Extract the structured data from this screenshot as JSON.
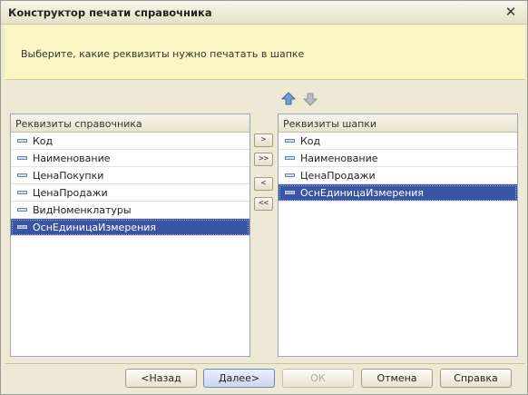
{
  "window": {
    "title": "Конструктор печати справочника",
    "close_glyph": "✕"
  },
  "hint": "Выберите, какие реквизиты нужно печатать в шапке",
  "left_list": {
    "header": "Реквизиты справочника",
    "items": [
      {
        "label": "Код"
      },
      {
        "label": "Наименование"
      },
      {
        "label": "ЦенаПокупки"
      },
      {
        "label": "ЦенаПродажи"
      },
      {
        "label": "ВидНоменклатуры"
      },
      {
        "label": "ОснЕдиницаИзмерения",
        "selected": true
      }
    ]
  },
  "right_list": {
    "header": "Реквизиты шапки",
    "items": [
      {
        "label": "Код"
      },
      {
        "label": "Наименование"
      },
      {
        "label": "ЦенаПродажи"
      },
      {
        "label": "ОснЕдиницаИзмерения",
        "selected": true
      }
    ]
  },
  "move_buttons": {
    "add_one": ">",
    "add_all": ">>",
    "remove_one": "<",
    "remove_all": "<<"
  },
  "order_buttons": {
    "up_icon": "arrow-up-icon",
    "down_icon": "arrow-down-icon"
  },
  "buttons": {
    "back": "<Назад",
    "next": "Далее>",
    "ok": "ОК",
    "cancel": "Отмена",
    "help": "Справка"
  }
}
